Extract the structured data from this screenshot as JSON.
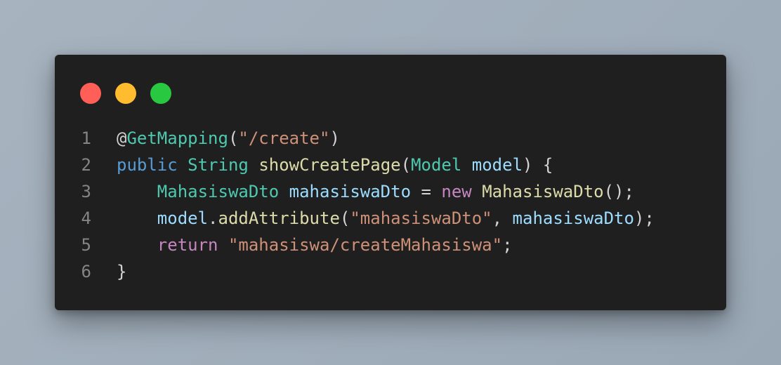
{
  "colors": {
    "background": "#a3b0bd",
    "window": "#1f1f1f",
    "close": "#ff5f57",
    "minimize": "#febc2e",
    "maximize": "#28c840"
  },
  "window_controls": [
    {
      "name": "close-button",
      "color": "#ff5f57"
    },
    {
      "name": "minimize-button",
      "color": "#febc2e"
    },
    {
      "name": "maximize-button",
      "color": "#28c840"
    }
  ],
  "code": {
    "language": "java",
    "lines": [
      {
        "number": "1",
        "tokens": [
          {
            "t": "@",
            "k": "plain"
          },
          {
            "t": "GetMapping",
            "k": "type"
          },
          {
            "t": "(",
            "k": "plain"
          },
          {
            "t": "\"/create\"",
            "k": "string"
          },
          {
            "t": ")",
            "k": "plain"
          }
        ]
      },
      {
        "number": "2",
        "tokens": [
          {
            "t": "public",
            "k": "keyword"
          },
          {
            "t": " ",
            "k": "plain"
          },
          {
            "t": "String",
            "k": "type"
          },
          {
            "t": " ",
            "k": "plain"
          },
          {
            "t": "showCreatePage",
            "k": "func"
          },
          {
            "t": "(",
            "k": "plain"
          },
          {
            "t": "Model",
            "k": "type"
          },
          {
            "t": " ",
            "k": "plain"
          },
          {
            "t": "model",
            "k": "var"
          },
          {
            "t": ") {",
            "k": "plain"
          }
        ]
      },
      {
        "number": "3",
        "tokens": [
          {
            "t": "    ",
            "k": "plain"
          },
          {
            "t": "MahasiswaDto",
            "k": "type"
          },
          {
            "t": " ",
            "k": "plain"
          },
          {
            "t": "mahasiswaDto",
            "k": "var"
          },
          {
            "t": " = ",
            "k": "plain"
          },
          {
            "t": "new",
            "k": "control"
          },
          {
            "t": " ",
            "k": "plain"
          },
          {
            "t": "MahasiswaDto",
            "k": "func"
          },
          {
            "t": "();",
            "k": "plain"
          }
        ]
      },
      {
        "number": "4",
        "tokens": [
          {
            "t": "    ",
            "k": "plain"
          },
          {
            "t": "model",
            "k": "var"
          },
          {
            "t": ".",
            "k": "plain"
          },
          {
            "t": "addAttribute",
            "k": "func"
          },
          {
            "t": "(",
            "k": "plain"
          },
          {
            "t": "\"mahasiswaDto\"",
            "k": "string"
          },
          {
            "t": ", ",
            "k": "plain"
          },
          {
            "t": "mahasiswaDto",
            "k": "var"
          },
          {
            "t": ");",
            "k": "plain"
          }
        ]
      },
      {
        "number": "5",
        "tokens": [
          {
            "t": "    ",
            "k": "plain"
          },
          {
            "t": "return",
            "k": "control"
          },
          {
            "t": " ",
            "k": "plain"
          },
          {
            "t": "\"mahasiswa/createMahasiswa\"",
            "k": "string"
          },
          {
            "t": ";",
            "k": "plain"
          }
        ]
      },
      {
        "number": "6",
        "tokens": [
          {
            "t": "}",
            "k": "plain"
          }
        ]
      }
    ]
  }
}
